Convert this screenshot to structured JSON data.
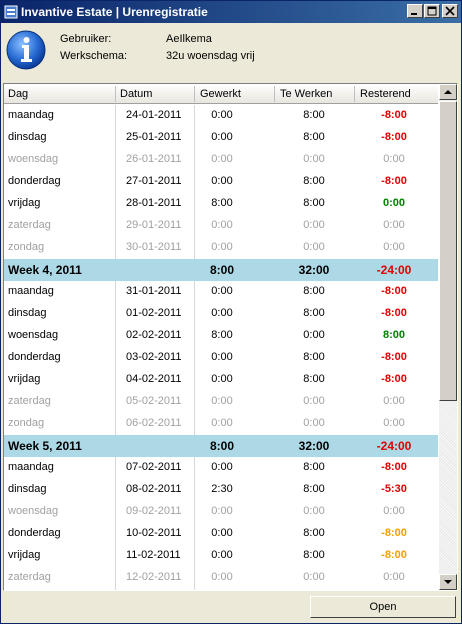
{
  "window": {
    "title": "Invantive Estate | Urenregistratie"
  },
  "header": {
    "gebruiker_label": "Gebruiker:",
    "gebruiker_value": "AeIlkema",
    "werkschema_label": "Werkschema:",
    "werkschema_value": "32u woensdag vrij"
  },
  "grid": {
    "columns": [
      "Dag",
      "Datum",
      "Gewerkt",
      "Te Werken",
      "Resterend"
    ],
    "rows": [
      {
        "dag": "maandag",
        "datum": "24-01-2011",
        "gewerkt": "0:00",
        "tewerken": "8:00",
        "resterend": "-8:00",
        "type": "day",
        "rest_color": "#e00000"
      },
      {
        "dag": "dinsdag",
        "datum": "25-01-2011",
        "gewerkt": "0:00",
        "tewerken": "8:00",
        "resterend": "-8:00",
        "type": "day",
        "rest_color": "#e00000"
      },
      {
        "dag": "woensdag",
        "datum": "26-01-2011",
        "gewerkt": "0:00",
        "tewerken": "0:00",
        "resterend": "0:00",
        "type": "muted",
        "rest_color": "#a0a0a0"
      },
      {
        "dag": "donderdag",
        "datum": "27-01-2011",
        "gewerkt": "0:00",
        "tewerken": "8:00",
        "resterend": "-8:00",
        "type": "day",
        "rest_color": "#e00000"
      },
      {
        "dag": "vrijdag",
        "datum": "28-01-2011",
        "gewerkt": "8:00",
        "tewerken": "8:00",
        "resterend": "0:00",
        "type": "day",
        "rest_color": "#008000"
      },
      {
        "dag": "zaterdag",
        "datum": "29-01-2011",
        "gewerkt": "0:00",
        "tewerken": "0:00",
        "resterend": "0:00",
        "type": "muted",
        "rest_color": "#a0a0a0"
      },
      {
        "dag": "zondag",
        "datum": "30-01-2011",
        "gewerkt": "0:00",
        "tewerken": "0:00",
        "resterend": "0:00",
        "type": "muted",
        "rest_color": "#a0a0a0"
      },
      {
        "dag": "Week 4, 2011",
        "datum": "",
        "gewerkt": "8:00",
        "tewerken": "32:00",
        "resterend": "-24:00",
        "type": "week",
        "rest_color": "#e00000"
      },
      {
        "dag": "maandag",
        "datum": "31-01-2011",
        "gewerkt": "0:00",
        "tewerken": "8:00",
        "resterend": "-8:00",
        "type": "day",
        "rest_color": "#e00000"
      },
      {
        "dag": "dinsdag",
        "datum": "01-02-2011",
        "gewerkt": "0:00",
        "tewerken": "8:00",
        "resterend": "-8:00",
        "type": "day",
        "rest_color": "#e00000"
      },
      {
        "dag": "woensdag",
        "datum": "02-02-2011",
        "gewerkt": "8:00",
        "tewerken": "0:00",
        "resterend": "8:00",
        "type": "day",
        "rest_color": "#008000"
      },
      {
        "dag": "donderdag",
        "datum": "03-02-2011",
        "gewerkt": "0:00",
        "tewerken": "8:00",
        "resterend": "-8:00",
        "type": "day",
        "rest_color": "#e00000"
      },
      {
        "dag": "vrijdag",
        "datum": "04-02-2011",
        "gewerkt": "0:00",
        "tewerken": "8:00",
        "resterend": "-8:00",
        "type": "day",
        "rest_color": "#e00000"
      },
      {
        "dag": "zaterdag",
        "datum": "05-02-2011",
        "gewerkt": "0:00",
        "tewerken": "0:00",
        "resterend": "0:00",
        "type": "muted",
        "rest_color": "#a0a0a0"
      },
      {
        "dag": "zondag",
        "datum": "06-02-2011",
        "gewerkt": "0:00",
        "tewerken": "0:00",
        "resterend": "0:00",
        "type": "muted",
        "rest_color": "#a0a0a0"
      },
      {
        "dag": "Week 5, 2011",
        "datum": "",
        "gewerkt": "8:00",
        "tewerken": "32:00",
        "resterend": "-24:00",
        "type": "week",
        "rest_color": "#e00000"
      },
      {
        "dag": "maandag",
        "datum": "07-02-2011",
        "gewerkt": "0:00",
        "tewerken": "8:00",
        "resterend": "-8:00",
        "type": "day",
        "rest_color": "#e00000"
      },
      {
        "dag": "dinsdag",
        "datum": "08-02-2011",
        "gewerkt": "2:30",
        "tewerken": "8:00",
        "resterend": "-5:30",
        "type": "day",
        "rest_color": "#e00000"
      },
      {
        "dag": "woensdag",
        "datum": "09-02-2011",
        "gewerkt": "0:00",
        "tewerken": "0:00",
        "resterend": "0:00",
        "type": "muted",
        "rest_color": "#a0a0a0"
      },
      {
        "dag": "donderdag",
        "datum": "10-02-2011",
        "gewerkt": "0:00",
        "tewerken": "8:00",
        "resterend": "-8:00",
        "type": "day",
        "rest_color": "#f0a000"
      },
      {
        "dag": "vrijdag",
        "datum": "11-02-2011",
        "gewerkt": "0:00",
        "tewerken": "8:00",
        "resterend": "-8:00",
        "type": "day",
        "rest_color": "#f0a000"
      },
      {
        "dag": "zaterdag",
        "datum": "12-02-2011",
        "gewerkt": "0:00",
        "tewerken": "0:00",
        "resterend": "0:00",
        "type": "muted",
        "rest_color": "#a0a0a0"
      }
    ]
  },
  "footer": {
    "open_label": "Open"
  },
  "icons": {
    "app": "app-icon",
    "info": "info-icon"
  },
  "colors": {
    "titlebar": "#0a246a",
    "week_row": "#add8e6",
    "negative": "#e00000",
    "positive": "#008000",
    "warning": "#f0a000"
  }
}
